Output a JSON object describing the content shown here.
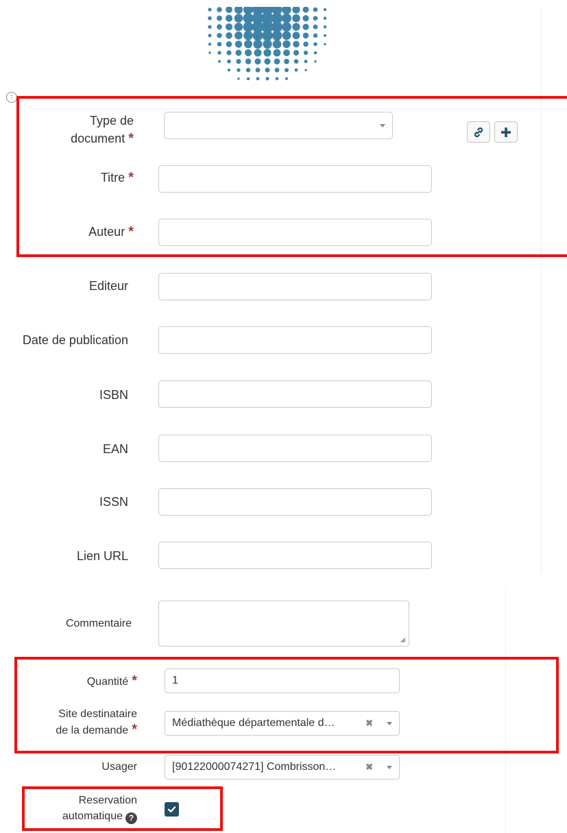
{
  "colors": {
    "accent": "#234e65",
    "logo_blue": "#3f84a8",
    "required": "#a03b3b",
    "highlight_box": "#ee1111"
  },
  "icons": {
    "scroll_top": "circled-up-arrow-icon",
    "link": "link-icon",
    "add": "plus-icon",
    "help": "question-circle-icon"
  },
  "form": {
    "type_document": {
      "label_line1": "Type de",
      "label_line2": "document",
      "required": "*",
      "value": ""
    },
    "titre": {
      "label": "Titre",
      "required": "*",
      "value": ""
    },
    "auteur": {
      "label": "Auteur",
      "required": "*",
      "value": ""
    },
    "editeur": {
      "label": "Editeur",
      "value": ""
    },
    "date_publication": {
      "label": "Date de publication",
      "value": ""
    },
    "isbn": {
      "label": "ISBN",
      "value": ""
    },
    "ean": {
      "label": "EAN",
      "value": ""
    },
    "issn": {
      "label": "ISSN",
      "value": ""
    },
    "lien_url": {
      "label": "Lien URL",
      "value": ""
    },
    "commentaire": {
      "label": "Commentaire",
      "value": ""
    },
    "quantite": {
      "label": "Quantité",
      "required": "*",
      "value": "1"
    },
    "site_destinataire": {
      "label_line1": "Site destinataire",
      "label_line2": "de la demande",
      "required": "*",
      "value": "Médiathèque départementale d…",
      "clear": "✖"
    },
    "usager": {
      "label": "Usager",
      "value": "[90122000074271] Combrisson…",
      "clear": "✖"
    },
    "reservation": {
      "label_line1": "Reservation",
      "label_line2": "automatique",
      "help": "?",
      "checked": true
    }
  }
}
